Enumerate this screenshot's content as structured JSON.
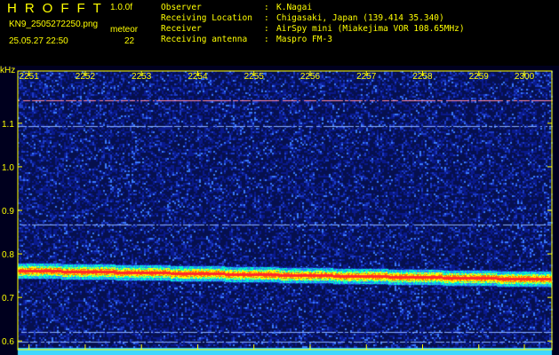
{
  "header": {
    "app_title": "HROFFT",
    "version": "1.0.0f",
    "filename": "KN9_2505272250.png",
    "meteor_label": "meteor",
    "datetime": "25.05.27 22:50",
    "meteor_count": "22",
    "info": [
      {
        "key": "Observer",
        "value": "K.Nagai"
      },
      {
        "key": "Receiving Location",
        "value": "Chigasaki, Japan (139.414 35.340)"
      },
      {
        "key": "Receiver",
        "value": "AirSpy mini (Miakejima VOR 108.65MHz)"
      },
      {
        "key": "Receiving antenna",
        "value": "Maspro FM-3"
      }
    ]
  },
  "colors": {
    "text": "#ffff00",
    "background": "#00001e",
    "noise": "#0a1a8c",
    "signal_core": "#ff2a2a",
    "signal_mid": "#ffff00",
    "signal_edge": "#00ffcc",
    "bottom_band": "#40d8ff"
  },
  "chart_data": {
    "type": "heatmap",
    "title": "",
    "ylabel": "kHz",
    "x_ticks": [
      "2251",
      "2252",
      "2253",
      "2254",
      "2255",
      "2256",
      "2257",
      "2258",
      "2259",
      "2300"
    ],
    "y_ticks": [
      "1.1",
      "1.0",
      "0.9",
      "0.8",
      "0.7",
      "0.6"
    ],
    "y_tick_values": [
      1.1,
      1.0,
      0.9,
      0.8,
      0.7,
      0.6
    ],
    "ylim": [
      0.58,
      1.22
    ],
    "xlim": [
      2250.8,
      2300.3
    ],
    "carrier_band": {
      "start_freq_khz": 0.762,
      "end_freq_khz": 0.742
    },
    "horizontal_lines_khz": [
      1.152,
      1.094,
      0.868,
      0.62,
      0.598
    ]
  }
}
